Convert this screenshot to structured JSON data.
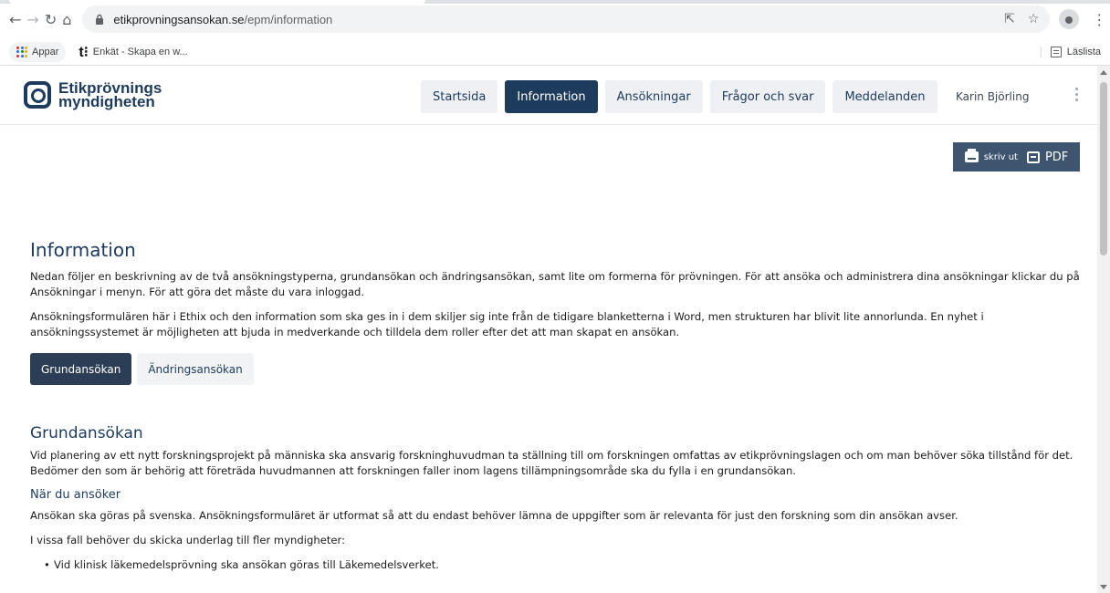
{
  "browser": {
    "url_host": "etikprovningsansokan.se",
    "url_path": "/epm/information",
    "bookmarks": [
      {
        "label": "Appar"
      },
      {
        "label": "Enkät - Skapa en w..."
      }
    ],
    "reading_list": "Läslista"
  },
  "site": {
    "logo_line1": "Etikprövnings",
    "logo_line2": "myndigheten",
    "nav": [
      {
        "label": "Startsida",
        "active": false
      },
      {
        "label": "Information",
        "active": true
      },
      {
        "label": "Ansökningar",
        "active": false
      },
      {
        "label": "Frågor och svar",
        "active": false
      },
      {
        "label": "Meddelanden",
        "active": false
      }
    ],
    "user": "Karin Björling"
  },
  "toolbar": {
    "print_label": "skriv ut",
    "pdf_label": "PDF"
  },
  "main": {
    "title": "Information",
    "intro1": "Nedan följer en beskrivning av de två ansökningstyperna, grundansökan och ändringsansökan, samt lite om formerna för prövningen. För att ansöka och administrera dina ansökningar klickar du på Ansökningar i menyn. För att göra det måste du vara inloggad.",
    "intro2": "Ansökningsformulären här i Ethix och den information som ska ges in i dem skiljer sig inte från de tidigare blanketterna i Word, men strukturen har blivit lite annorlunda. En nyhet i ansökningssystemet är möjligheten att bjuda in medverkande och tilldela dem roller efter det att man skapat en ansökan.",
    "tabs": [
      {
        "label": "Grundansökan",
        "active": true
      },
      {
        "label": "Ändringsansökan",
        "active": false
      }
    ],
    "section_title": "Grundansökan",
    "section_text": "Vid planering av ett nytt forskningsprojekt på människa ska ansvarig forskninghuvudman ta ställning till om forskningen omfattas av etikprövningslagen och om man behöver söka tillstånd för det. Bedömer den som är behörig att företräda huvudmannen att forskningen faller inom lagens tillämpningsområde ska du fylla i en grundansökan.",
    "sub_title": "När du ansöker",
    "sub_text1": "Ansökan ska göras på svenska. Ansökningsformuläret är utformat så att du endast behöver lämna de uppgifter som är relevanta för just den forskning som din ansökan avser.",
    "sub_text2": "I vissa fall behöver du skicka underlag till fler myndigheter:",
    "list": [
      "Vid klinisk läkemedelsprövning ska ansökan göras till Läkemedelsverket."
    ]
  }
}
